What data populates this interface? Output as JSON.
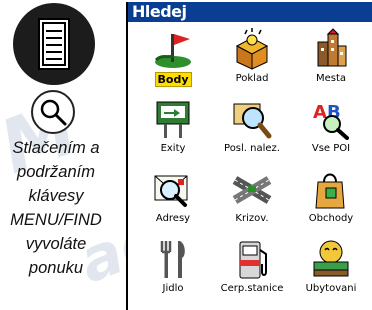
{
  "caption": {
    "lines": [
      "Stlačením a",
      "podržaním",
      "klávesy",
      "MENU/FIND",
      "vyvoláte",
      "ponuku"
    ]
  },
  "screen": {
    "title": "Hledej",
    "selected": "Body",
    "items": [
      {
        "label": "Body",
        "icon": "flag-waypoint-icon"
      },
      {
        "label": "Poklad",
        "icon": "treasure-chest-icon"
      },
      {
        "label": "Mesta",
        "icon": "city-buildings-icon"
      },
      {
        "label": "Exity",
        "icon": "highway-exit-sign-icon"
      },
      {
        "label": "Posl. nalez.",
        "icon": "recent-finds-magnifier-icon"
      },
      {
        "label": "Vse POI",
        "icon": "all-poi-ab-magnifier-icon"
      },
      {
        "label": "Adresy",
        "icon": "address-envelope-icon"
      },
      {
        "label": "Krizov.",
        "icon": "intersection-roads-icon"
      },
      {
        "label": "Obchody",
        "icon": "shopping-bag-icon"
      },
      {
        "label": "Jidlo",
        "icon": "fork-knife-icon"
      },
      {
        "label": "Cerp.stanice",
        "icon": "fuel-pump-icon"
      },
      {
        "label": "Ubytovani",
        "icon": "lodging-bed-icon"
      }
    ]
  },
  "colors": {
    "titlebar": "#0a3e92",
    "selection": "#ffdd00"
  }
}
